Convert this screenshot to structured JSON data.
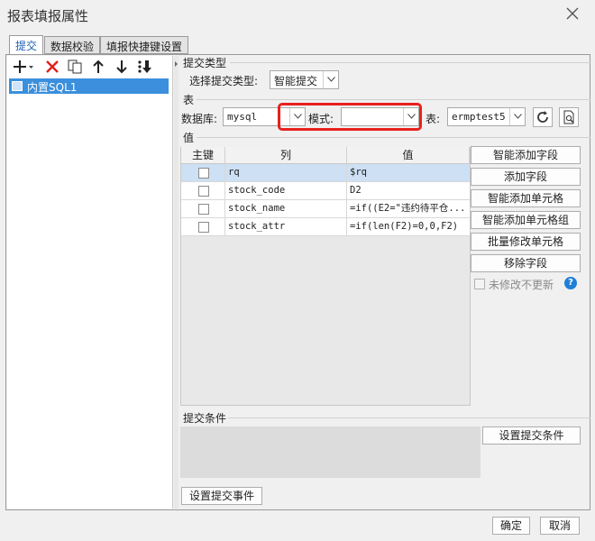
{
  "window": {
    "title": "报表填报属性"
  },
  "tabs": [
    {
      "label": "提交",
      "active": true
    },
    {
      "label": "数据校验",
      "active": false
    },
    {
      "label": "填报快捷键设置",
      "active": false
    }
  ],
  "tree": {
    "items": [
      {
        "label": "内置SQL1",
        "selected": true
      }
    ]
  },
  "submit_type": {
    "section": "提交类型",
    "label": "选择提交类型:",
    "value": "智能提交"
  },
  "table_section": {
    "section": "表",
    "database_label": "数据库:",
    "database_value": "mysql",
    "schema_label": "模式:",
    "schema_value": "",
    "table_label": "表:",
    "table_value": "ermptest5"
  },
  "value_section": {
    "section": "值",
    "columns": [
      "主键",
      "列",
      "值"
    ],
    "rows": [
      {
        "key": false,
        "column": "rq",
        "value": "$rq",
        "selected": true
      },
      {
        "key": false,
        "column": "stock_code",
        "value": "D2",
        "selected": false
      },
      {
        "key": false,
        "column": "stock_name",
        "value": "=if((E2=\"违约待平仓...",
        "selected": false
      },
      {
        "key": false,
        "column": "stock_attr",
        "value": "=if(len(F2)=0,0,F2)",
        "selected": false
      }
    ]
  },
  "side_buttons": {
    "smart_add_field": "智能添加字段",
    "add_field": "添加字段",
    "smart_add_cell": "智能添加单元格",
    "smart_add_cell_group": "智能添加单元格组",
    "batch_modify_cell": "批量修改单元格",
    "remove_field": "移除字段",
    "no_update_unmodified": "未修改不更新"
  },
  "submit_condition": {
    "section": "提交条件",
    "button": "设置提交条件"
  },
  "submit_event_button": "设置提交事件",
  "footer": {
    "ok": "确定",
    "cancel": "取消"
  },
  "colors": {
    "accent": "#3b8fdc",
    "highlight": "#e8211d",
    "delete": "#e0201b",
    "help": "#1f7fd6"
  }
}
